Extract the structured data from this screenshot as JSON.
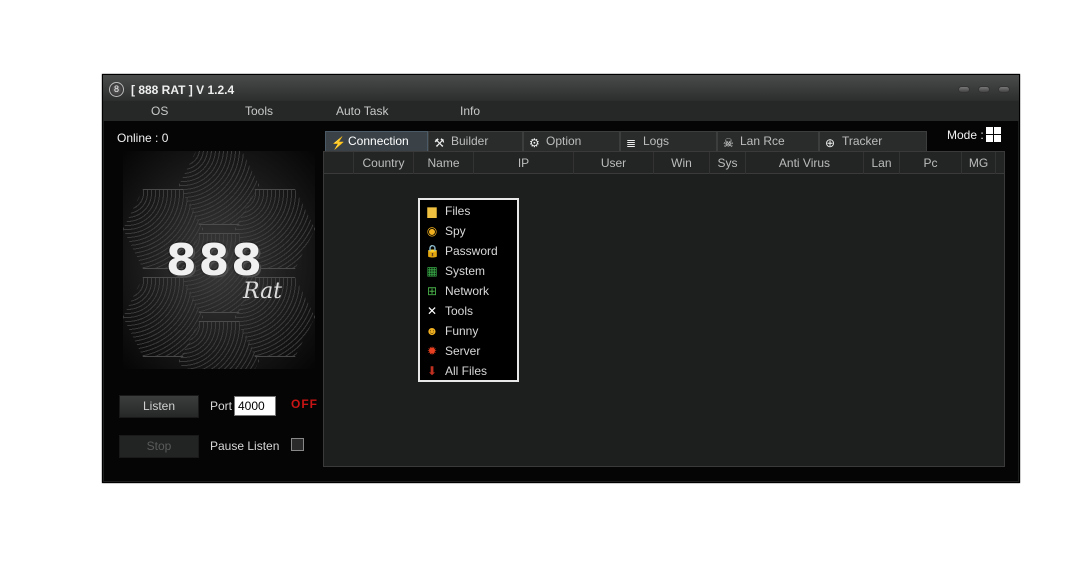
{
  "window": {
    "title": "[ 888 RAT ] V 1.2.4",
    "app_icon_glyph": "8"
  },
  "menu": [
    "OS",
    "Tools",
    "Auto Task",
    "Info"
  ],
  "status": {
    "online": "Online : 0",
    "listen_state": "OFF"
  },
  "logo": {
    "number": "888",
    "word": "Rat"
  },
  "controls": {
    "listen_label": "Listen",
    "stop_label": "Stop",
    "port_label": "Port",
    "port_value": "4000",
    "pause_label": "Pause Listen"
  },
  "mode": {
    "label": "Mode :",
    "icon": "windows-icon"
  },
  "tabs": [
    {
      "label": "Connection",
      "icon": "plug-icon",
      "glyph": "⚡"
    },
    {
      "label": "Builder",
      "icon": "tools-icon",
      "glyph": "⚒"
    },
    {
      "label": "Option",
      "icon": "gear-icon",
      "glyph": "⚙"
    },
    {
      "label": "Logs",
      "icon": "stack-icon",
      "glyph": "≣"
    },
    {
      "label": "Lan Rce",
      "icon": "skull-icon",
      "glyph": "☠"
    },
    {
      "label": "Tracker",
      "icon": "globe-icon",
      "glyph": "⊕"
    }
  ],
  "columns": [
    "Country",
    "Name",
    "IP",
    "User",
    "Win",
    "Sys",
    "Anti Virus",
    "Lan",
    "Pc",
    "MG"
  ],
  "context_menu": [
    {
      "label": "Files",
      "icon": "folder-icon",
      "glyph": "▆",
      "color": "#f0c040"
    },
    {
      "label": "Spy",
      "icon": "eye-icon",
      "glyph": "◉",
      "color": "#f0b020"
    },
    {
      "label": "Password",
      "icon": "lock-icon",
      "glyph": "🔒",
      "color": "#e0a020"
    },
    {
      "label": "System",
      "icon": "windows-logo-icon",
      "glyph": "▦",
      "color": "#3ab04a"
    },
    {
      "label": "Network",
      "icon": "network-icon",
      "glyph": "⊞",
      "color": "#4ab04a"
    },
    {
      "label": "Tools",
      "icon": "wrench-icon",
      "glyph": "✕",
      "color": "#ffffff"
    },
    {
      "label": "Funny",
      "icon": "smiley-icon",
      "glyph": "☻",
      "color": "#f0b020"
    },
    {
      "label": "Server",
      "icon": "burst-icon",
      "glyph": "✹",
      "color": "#e84020"
    },
    {
      "label": "All Files",
      "icon": "download-icon",
      "glyph": "⬇",
      "color": "#c03020"
    }
  ]
}
